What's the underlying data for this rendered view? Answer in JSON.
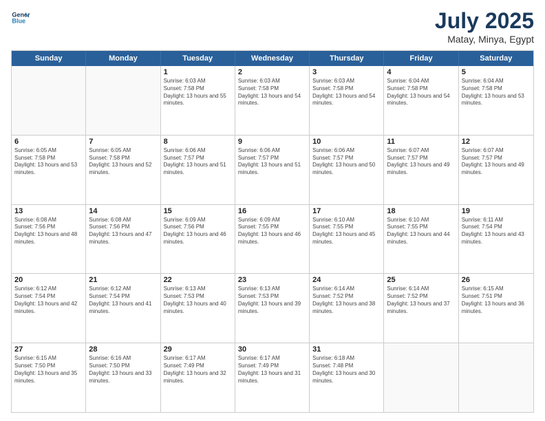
{
  "header": {
    "logo_line1": "General",
    "logo_line2": "Blue",
    "month": "July 2025",
    "location": "Matay, Minya, Egypt"
  },
  "weekdays": [
    "Sunday",
    "Monday",
    "Tuesday",
    "Wednesday",
    "Thursday",
    "Friday",
    "Saturday"
  ],
  "weeks": [
    [
      {
        "day": "",
        "empty": true
      },
      {
        "day": "",
        "empty": true
      },
      {
        "day": "1",
        "sunrise": "Sunrise: 6:03 AM",
        "sunset": "Sunset: 7:58 PM",
        "daylight": "Daylight: 13 hours and 55 minutes."
      },
      {
        "day": "2",
        "sunrise": "Sunrise: 6:03 AM",
        "sunset": "Sunset: 7:58 PM",
        "daylight": "Daylight: 13 hours and 54 minutes."
      },
      {
        "day": "3",
        "sunrise": "Sunrise: 6:03 AM",
        "sunset": "Sunset: 7:58 PM",
        "daylight": "Daylight: 13 hours and 54 minutes."
      },
      {
        "day": "4",
        "sunrise": "Sunrise: 6:04 AM",
        "sunset": "Sunset: 7:58 PM",
        "daylight": "Daylight: 13 hours and 54 minutes."
      },
      {
        "day": "5",
        "sunrise": "Sunrise: 6:04 AM",
        "sunset": "Sunset: 7:58 PM",
        "daylight": "Daylight: 13 hours and 53 minutes."
      }
    ],
    [
      {
        "day": "6",
        "sunrise": "Sunrise: 6:05 AM",
        "sunset": "Sunset: 7:58 PM",
        "daylight": "Daylight: 13 hours and 53 minutes."
      },
      {
        "day": "7",
        "sunrise": "Sunrise: 6:05 AM",
        "sunset": "Sunset: 7:58 PM",
        "daylight": "Daylight: 13 hours and 52 minutes."
      },
      {
        "day": "8",
        "sunrise": "Sunrise: 6:06 AM",
        "sunset": "Sunset: 7:57 PM",
        "daylight": "Daylight: 13 hours and 51 minutes."
      },
      {
        "day": "9",
        "sunrise": "Sunrise: 6:06 AM",
        "sunset": "Sunset: 7:57 PM",
        "daylight": "Daylight: 13 hours and 51 minutes."
      },
      {
        "day": "10",
        "sunrise": "Sunrise: 6:06 AM",
        "sunset": "Sunset: 7:57 PM",
        "daylight": "Daylight: 13 hours and 50 minutes."
      },
      {
        "day": "11",
        "sunrise": "Sunrise: 6:07 AM",
        "sunset": "Sunset: 7:57 PM",
        "daylight": "Daylight: 13 hours and 49 minutes."
      },
      {
        "day": "12",
        "sunrise": "Sunrise: 6:07 AM",
        "sunset": "Sunset: 7:57 PM",
        "daylight": "Daylight: 13 hours and 49 minutes."
      }
    ],
    [
      {
        "day": "13",
        "sunrise": "Sunrise: 6:08 AM",
        "sunset": "Sunset: 7:56 PM",
        "daylight": "Daylight: 13 hours and 48 minutes."
      },
      {
        "day": "14",
        "sunrise": "Sunrise: 6:08 AM",
        "sunset": "Sunset: 7:56 PM",
        "daylight": "Daylight: 13 hours and 47 minutes."
      },
      {
        "day": "15",
        "sunrise": "Sunrise: 6:09 AM",
        "sunset": "Sunset: 7:56 PM",
        "daylight": "Daylight: 13 hours and 46 minutes."
      },
      {
        "day": "16",
        "sunrise": "Sunrise: 6:09 AM",
        "sunset": "Sunset: 7:55 PM",
        "daylight": "Daylight: 13 hours and 46 minutes."
      },
      {
        "day": "17",
        "sunrise": "Sunrise: 6:10 AM",
        "sunset": "Sunset: 7:55 PM",
        "daylight": "Daylight: 13 hours and 45 minutes."
      },
      {
        "day": "18",
        "sunrise": "Sunrise: 6:10 AM",
        "sunset": "Sunset: 7:55 PM",
        "daylight": "Daylight: 13 hours and 44 minutes."
      },
      {
        "day": "19",
        "sunrise": "Sunrise: 6:11 AM",
        "sunset": "Sunset: 7:54 PM",
        "daylight": "Daylight: 13 hours and 43 minutes."
      }
    ],
    [
      {
        "day": "20",
        "sunrise": "Sunrise: 6:12 AM",
        "sunset": "Sunset: 7:54 PM",
        "daylight": "Daylight: 13 hours and 42 minutes."
      },
      {
        "day": "21",
        "sunrise": "Sunrise: 6:12 AM",
        "sunset": "Sunset: 7:54 PM",
        "daylight": "Daylight: 13 hours and 41 minutes."
      },
      {
        "day": "22",
        "sunrise": "Sunrise: 6:13 AM",
        "sunset": "Sunset: 7:53 PM",
        "daylight": "Daylight: 13 hours and 40 minutes."
      },
      {
        "day": "23",
        "sunrise": "Sunrise: 6:13 AM",
        "sunset": "Sunset: 7:53 PM",
        "daylight": "Daylight: 13 hours and 39 minutes."
      },
      {
        "day": "24",
        "sunrise": "Sunrise: 6:14 AM",
        "sunset": "Sunset: 7:52 PM",
        "daylight": "Daylight: 13 hours and 38 minutes."
      },
      {
        "day": "25",
        "sunrise": "Sunrise: 6:14 AM",
        "sunset": "Sunset: 7:52 PM",
        "daylight": "Daylight: 13 hours and 37 minutes."
      },
      {
        "day": "26",
        "sunrise": "Sunrise: 6:15 AM",
        "sunset": "Sunset: 7:51 PM",
        "daylight": "Daylight: 13 hours and 36 minutes."
      }
    ],
    [
      {
        "day": "27",
        "sunrise": "Sunrise: 6:15 AM",
        "sunset": "Sunset: 7:50 PM",
        "daylight": "Daylight: 13 hours and 35 minutes."
      },
      {
        "day": "28",
        "sunrise": "Sunrise: 6:16 AM",
        "sunset": "Sunset: 7:50 PM",
        "daylight": "Daylight: 13 hours and 33 minutes."
      },
      {
        "day": "29",
        "sunrise": "Sunrise: 6:17 AM",
        "sunset": "Sunset: 7:49 PM",
        "daylight": "Daylight: 13 hours and 32 minutes."
      },
      {
        "day": "30",
        "sunrise": "Sunrise: 6:17 AM",
        "sunset": "Sunset: 7:49 PM",
        "daylight": "Daylight: 13 hours and 31 minutes."
      },
      {
        "day": "31",
        "sunrise": "Sunrise: 6:18 AM",
        "sunset": "Sunset: 7:48 PM",
        "daylight": "Daylight: 13 hours and 30 minutes."
      },
      {
        "day": "",
        "empty": true
      },
      {
        "day": "",
        "empty": true
      }
    ]
  ]
}
